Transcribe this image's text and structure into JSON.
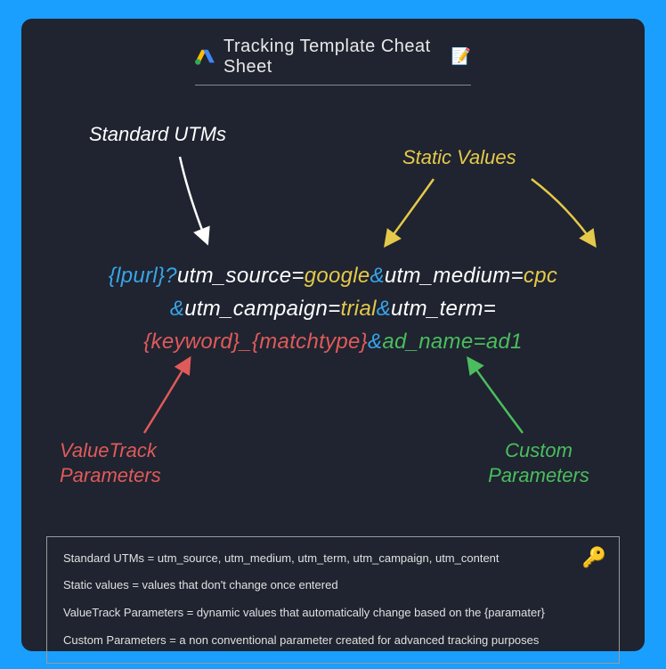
{
  "header": {
    "title": "Tracking Template Cheat Sheet"
  },
  "labels": {
    "standard": "Standard UTMs",
    "static": "Static Values",
    "valuetrack": "ValueTrack\nParameters",
    "custom": "Custom\nParameters"
  },
  "url": {
    "p1": "{lpurl}?",
    "p2": "utm_source",
    "p3": "=",
    "p4": "google",
    "p5": "&",
    "p6": "utm_medium",
    "p7": "=",
    "p8": "cpc",
    "p9": "&",
    "p10": "utm_campaign",
    "p11": "=",
    "p12": "trial",
    "p13": "&",
    "p14": "utm_term",
    "p15": "=",
    "p16": "{keyword}_{matchtype}",
    "p17": "&",
    "p18": "ad_name",
    "p19": "=",
    "p20": "ad1"
  },
  "legend": {
    "l1": "Standard UTMs = utm_source, utm_medium, utm_term, utm_campaign, utm_content",
    "l2": "Static values = values that don't change once entered",
    "l3": "ValueTrack Parameters = dynamic values that automatically change based on the {paramater}",
    "l4": "Custom Parameters = a non conventional parameter created for advanced tracking purposes"
  }
}
